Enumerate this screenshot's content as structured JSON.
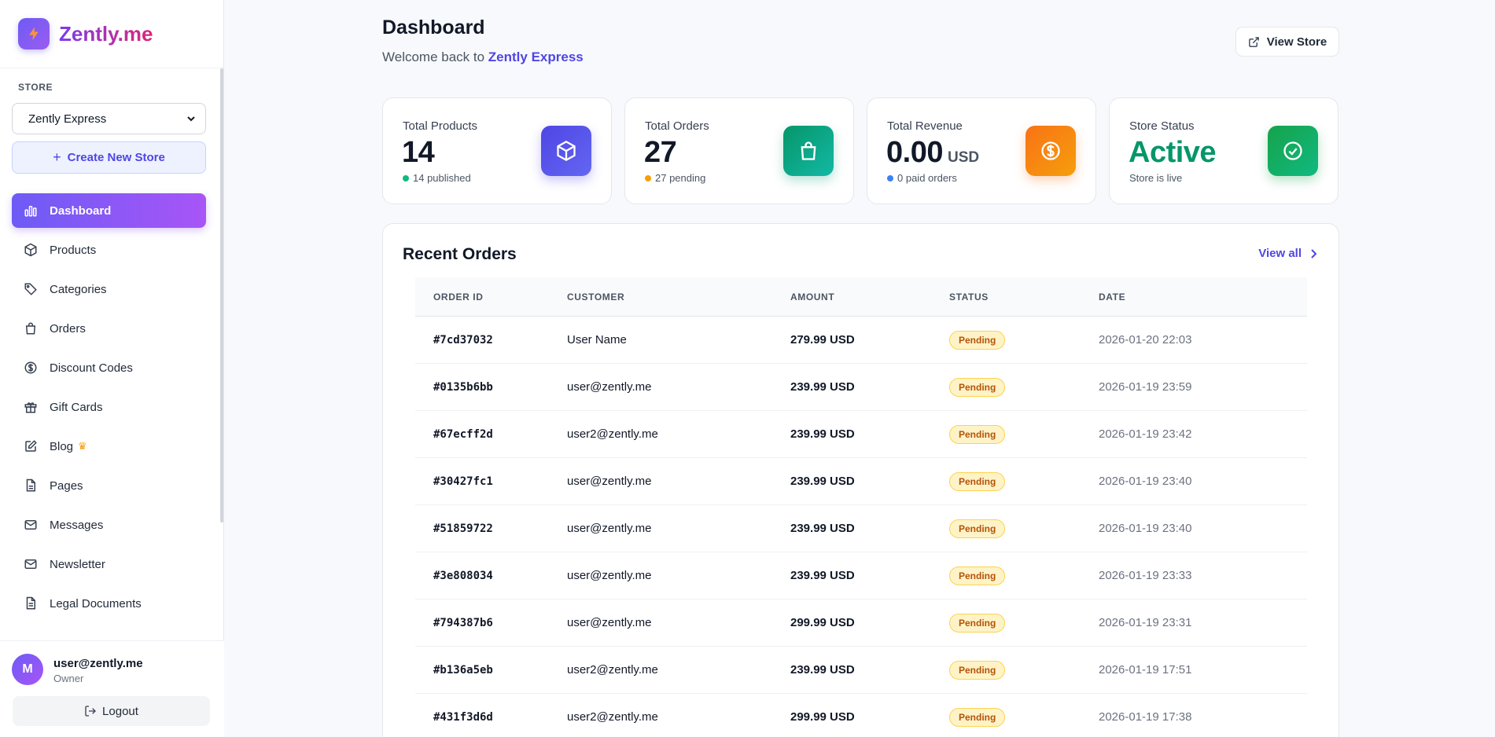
{
  "brand": {
    "name": "Zently.me"
  },
  "sidebar": {
    "store_label": "STORE",
    "store_select": "Zently Express",
    "create_store": "Create New Store",
    "items": [
      {
        "label": "Dashboard",
        "icon": "bar-chart-icon",
        "active": true
      },
      {
        "label": "Products",
        "icon": "box-icon"
      },
      {
        "label": "Categories",
        "icon": "tag-icon"
      },
      {
        "label": "Orders",
        "icon": "shopping-bag-icon"
      },
      {
        "label": "Discount Codes",
        "icon": "dollar-circle-icon"
      },
      {
        "label": "Gift Cards",
        "icon": "gift-icon"
      },
      {
        "label": "Blog",
        "icon": "edit-icon",
        "badge": "crown-icon"
      },
      {
        "label": "Pages",
        "icon": "file-icon"
      },
      {
        "label": "Messages",
        "icon": "mail-icon"
      },
      {
        "label": "Newsletter",
        "icon": "mail-icon"
      },
      {
        "label": "Legal Documents",
        "icon": "file-text-icon"
      }
    ],
    "user": {
      "initial": "M",
      "email": "user@zently.me",
      "role": "Owner"
    },
    "logout": "Logout"
  },
  "header": {
    "title": "Dashboard",
    "welcome_prefix": "Welcome back to ",
    "store_name": "Zently Express",
    "view_store": "View Store"
  },
  "stats": {
    "products": {
      "label": "Total Products",
      "value": "14",
      "sub": "14 published",
      "dot_color": "#10b981",
      "icon_color": "#5b5bf0"
    },
    "orders": {
      "label": "Total Orders",
      "value": "27",
      "sub": "27 pending",
      "dot_color": "#f59e0b",
      "icon_color": "#10a37f"
    },
    "revenue": {
      "label": "Total Revenue",
      "value": "0.00",
      "unit": "USD",
      "sub": "0 paid orders",
      "dot_color": "#3b82f6",
      "icon_color": "#f97316"
    },
    "status": {
      "label": "Store Status",
      "value": "Active",
      "sub": "Store is live",
      "icon_color": "#16a34a"
    }
  },
  "recent_orders": {
    "title": "Recent Orders",
    "view_all": "View all",
    "columns": [
      "ORDER ID",
      "CUSTOMER",
      "AMOUNT",
      "STATUS",
      "DATE"
    ],
    "rows": [
      {
        "id": "#7cd37032",
        "customer": "User Name",
        "amount": "279.99 USD",
        "status": "Pending",
        "date": "2026-01-20 22:03"
      },
      {
        "id": "#0135b6bb",
        "customer": "user@zently.me",
        "amount": "239.99 USD",
        "status": "Pending",
        "date": "2026-01-19 23:59"
      },
      {
        "id": "#67ecff2d",
        "customer": "user2@zently.me",
        "amount": "239.99 USD",
        "status": "Pending",
        "date": "2026-01-19 23:42"
      },
      {
        "id": "#30427fc1",
        "customer": "user@zently.me",
        "amount": "239.99 USD",
        "status": "Pending",
        "date": "2026-01-19 23:40"
      },
      {
        "id": "#51859722",
        "customer": "user@zently.me",
        "amount": "239.99 USD",
        "status": "Pending",
        "date": "2026-01-19 23:40"
      },
      {
        "id": "#3e808034",
        "customer": "user@zently.me",
        "amount": "239.99 USD",
        "status": "Pending",
        "date": "2026-01-19 23:33"
      },
      {
        "id": "#794387b6",
        "customer": "user@zently.me",
        "amount": "299.99 USD",
        "status": "Pending",
        "date": "2026-01-19 23:31"
      },
      {
        "id": "#b136a5eb",
        "customer": "user2@zently.me",
        "amount": "239.99 USD",
        "status": "Pending",
        "date": "2026-01-19 17:51"
      },
      {
        "id": "#431f3d6d",
        "customer": "user2@zently.me",
        "amount": "299.99 USD",
        "status": "Pending",
        "date": "2026-01-19 17:38"
      }
    ]
  }
}
